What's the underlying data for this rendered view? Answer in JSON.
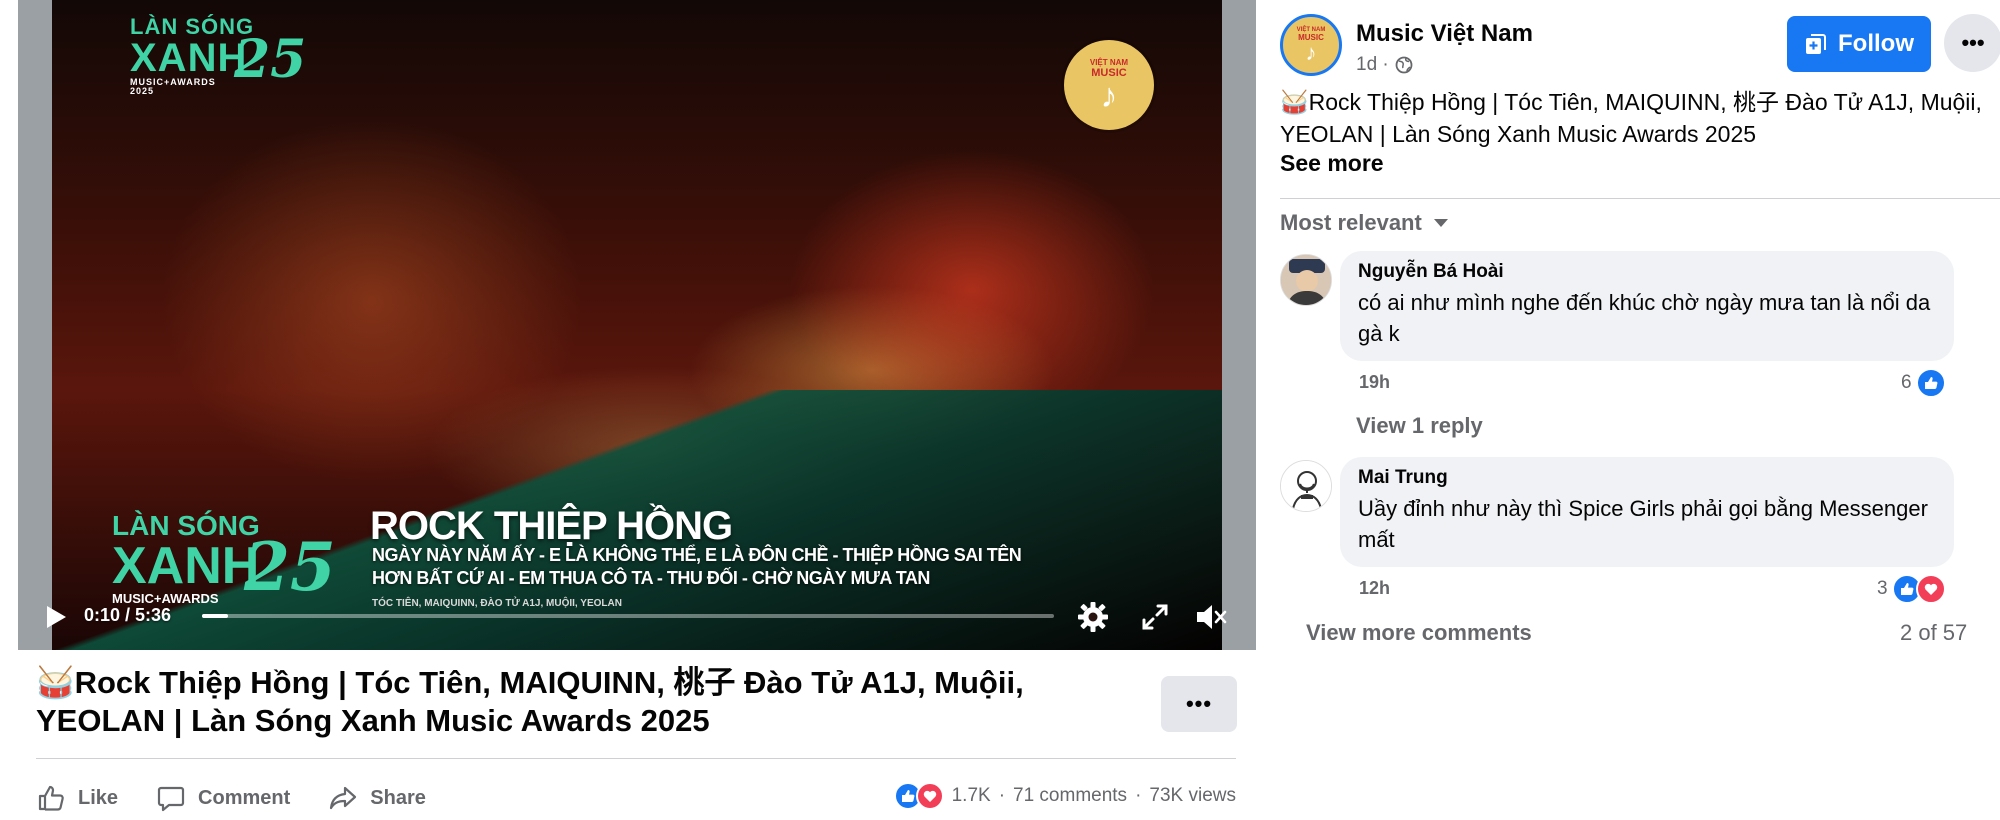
{
  "video": {
    "logo_line1": "LÀN SÓNG",
    "logo_line2": "XANH",
    "logo_line3": "MUSIC+AWARDS",
    "logo_year": "2025",
    "logo_num": "25",
    "badge_top": "VIỆT NAM",
    "badge_label": "MUSIC",
    "song_title": "ROCK THIỆP HỒNG",
    "song_line1": "NGÀY NÀY NĂM ẤY - E LÀ KHÔNG THỂ, E LÀ ĐÔN CHỀ - THIỆP HỒNG SAI TÊN",
    "song_line2": "HƠN BẤT CỨ AI - EM THUA CÔ TA - THU ĐỐI - CHỜ NGÀY MƯA TAN",
    "song_credit": "TÓC TIÊN, MAIQUINN, ĐÀO TỬ A1J, MUỘII, YEOLAN",
    "time_display": "0:10 / 5:36",
    "progress_fraction": 0.03,
    "accent": "#3fd3a6"
  },
  "post": {
    "title": "🥁Rock Thiệp Hồng | Tóc Tiên, MAIQUINN, 桃子 Đào Tử A1J, Muộii, YEOLAN | Làn Sóng Xanh Music Awards 2025",
    "more_label": "•••",
    "actions": {
      "like": "Like",
      "comment": "Comment",
      "share": "Share"
    },
    "reactions_count": "1.7K",
    "comments_count": "71 comments",
    "views_count": "73K views",
    "sep": "·"
  },
  "page": {
    "name": "Music Việt Nam",
    "age": "1d ·",
    "follow_label": "Follow",
    "more_label": "•••",
    "caption": "🥁Rock Thiệp Hồng | Tóc Tiên, MAIQUINN, 桃子 Đào Tử A1J, Muộii, YEOLAN | Làn Sóng Xanh Music Awards 2025",
    "see_more": "See more",
    "avatar_top": "VIỆT NAM",
    "avatar_label": "MUSIC"
  },
  "comments": {
    "sort_label": "Most relevant",
    "items": [
      {
        "author": "Nguyễn Bá Hoài",
        "text": "có ai như mình nghe đến khúc chờ ngày mưa tan là nổi da gà k",
        "time": "19h",
        "reactions": "6"
      },
      {
        "author": "Mai Trung",
        "text": "Uầy đỉnh như này thì Spice Girls phải gọi bằng Messenger mất",
        "time": "12h",
        "reactions": "3"
      }
    ],
    "view_reply": "View 1 reply",
    "view_more": "View more comments",
    "count": "2 of 57"
  },
  "colors": {
    "brand": "#1877f2",
    "love": "#f33e58",
    "muted": "#65676b",
    "bubble": "#f0f2f5"
  }
}
